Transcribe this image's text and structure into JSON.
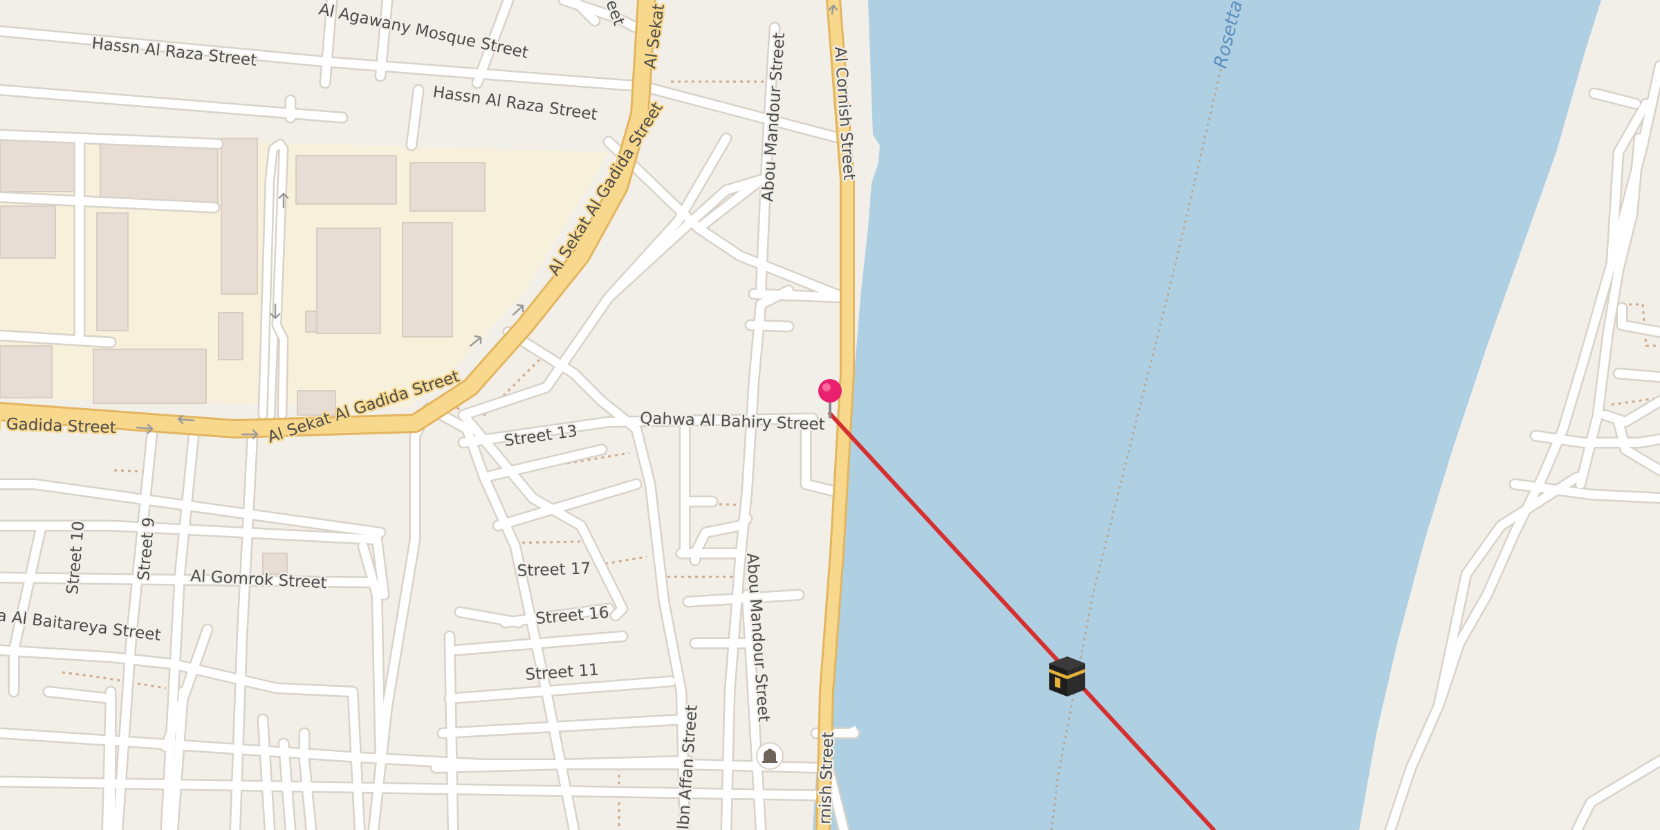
{
  "map": {
    "colors": {
      "land": "#f2efe9",
      "water": "#afcfe3",
      "campus": "#f7f1dc",
      "building": "#e8ddd4",
      "road_minor": "#ffffff",
      "road_casing": "#d8d2c8",
      "road_primary": "#f7d88c",
      "road_primary_casing": "#e3b55f",
      "qibla_line": "#d62f2f",
      "pin": "#e8206e",
      "path": "#cfa98a"
    },
    "water_label": "Rosetta",
    "street_labels": [
      "Al Agawany Mosque Street",
      "Hassn Al Raza Street",
      "Hassn Al Raza Street",
      "Al Sekat",
      "Al Sekat Al Gadida Street",
      "Al Sekat Al Gadida Street",
      "l Gadida Street",
      "Abou Mandour Street",
      "Al Cornish Street",
      "Street 13",
      "Qahwa Al Bahiry Street",
      "Street 10",
      "Street 9",
      "Al Gomrok Street",
      "a Al Baitareya Street",
      "Street 17",
      "Street 16",
      "Street 11",
      "Ibn Affan Street",
      "Abou Mandour Street",
      "rnish Street",
      "reet"
    ],
    "markers": {
      "location_pin": "map-pin-icon",
      "kaaba": "kaaba-icon",
      "poi": "mosque-poi-icon"
    }
  }
}
